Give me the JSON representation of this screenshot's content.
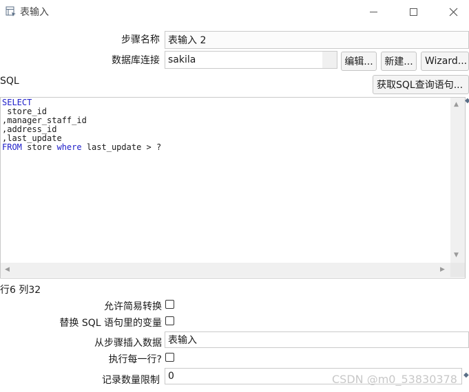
{
  "window": {
    "title": "表输入"
  },
  "form": {
    "step_name_label": "步骤名称",
    "step_name_value": "表输入 2",
    "db_conn_label": "数据库连接",
    "db_conn_value": "sakila",
    "edit_button": "编辑...",
    "new_button": "新建...",
    "wizard_button": "Wizard...",
    "sql_label": "SQL",
    "get_sql_button": "获取SQL查询语句...",
    "sql_lines": [
      {
        "kw": "SELECT",
        "rest": ""
      },
      {
        "kw": "",
        "rest": " store_id"
      },
      {
        "kw": "",
        "rest": ",manager_staff_id"
      },
      {
        "kw": "",
        "rest": ",address_id"
      },
      {
        "kw": "",
        "rest": ",last_update"
      },
      {
        "kw": "FROM",
        "rest": " store ",
        "kw2": "where",
        "rest2": " last_update > ?"
      }
    ],
    "cursor_position": "行6 列32",
    "allow_lazy_conversion_label": "允许简易转换",
    "replace_variables_label": "替换 SQL 语句里的变量",
    "insert_from_step_label": "从步骤插入数据",
    "insert_from_step_value": "表输入",
    "execute_each_row_label": "执行每一行?",
    "limit_label": "记录数量限制",
    "limit_value": "0"
  },
  "watermark": "CSDN @m0_53830378",
  "icons": [
    "table-input-icon",
    "minimize-icon",
    "maximize-icon",
    "close-icon",
    "scroll-up-icon",
    "scroll-down-icon",
    "scroll-left-icon",
    "scroll-right-icon"
  ]
}
